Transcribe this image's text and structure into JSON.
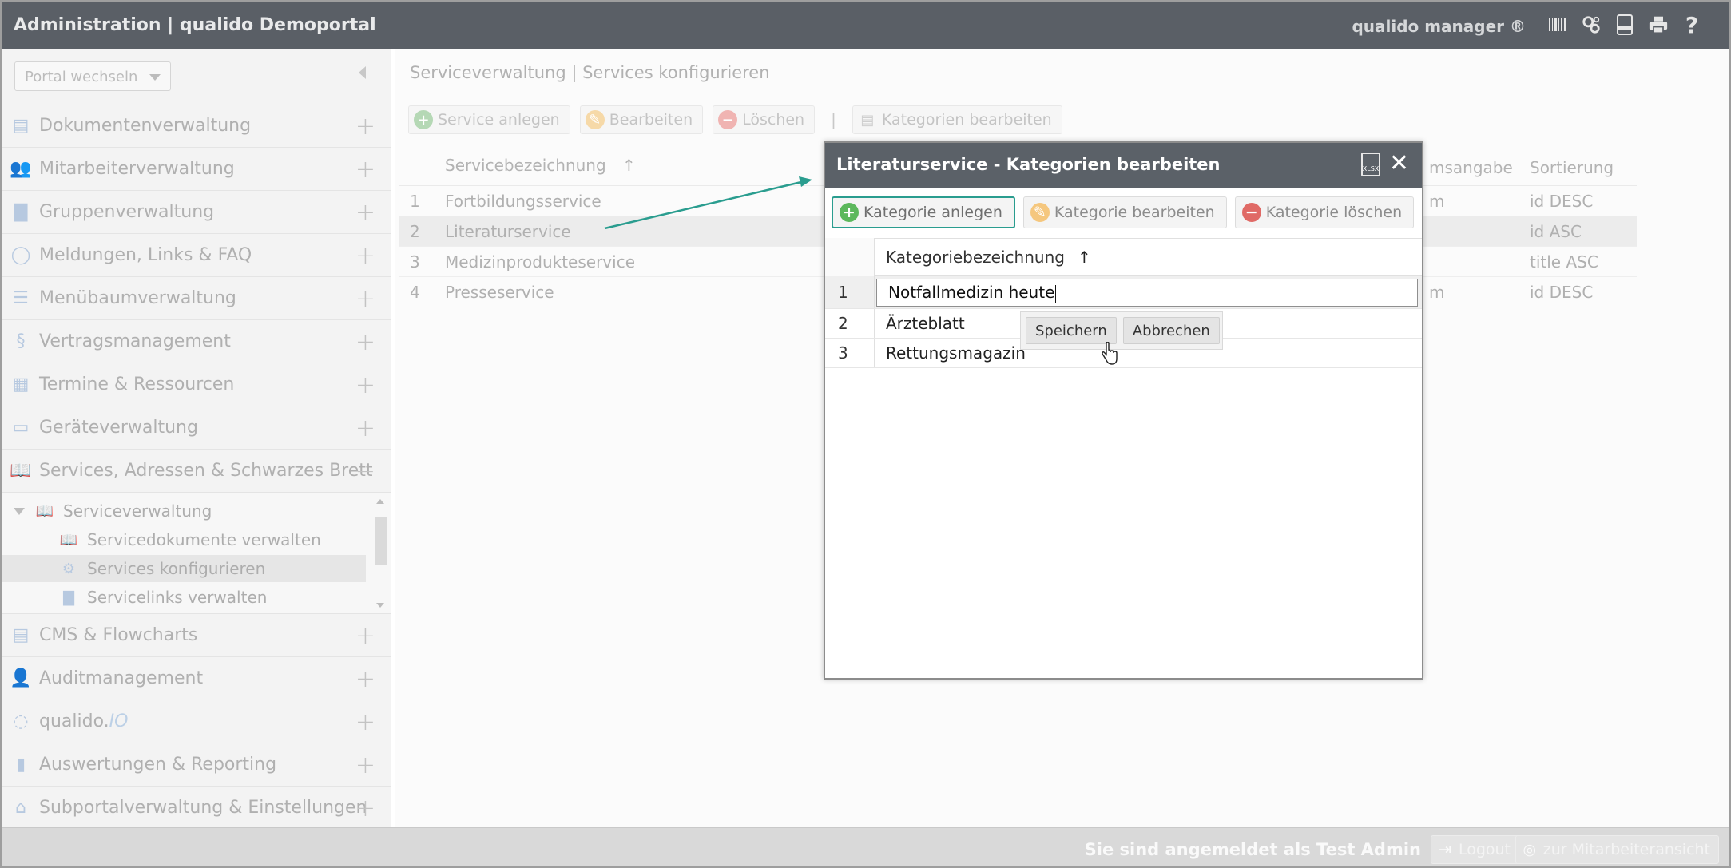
{
  "header": {
    "title": "Administration | qualido Demoportal",
    "product": "qualido manager ®",
    "icons": [
      "barcode-icon",
      "gears-icon",
      "xlsx-export-icon",
      "print-icon",
      "help-icon"
    ]
  },
  "sidebar": {
    "portal_select": "Portal wechseln",
    "items": [
      {
        "label": "Dokumentenverwaltung",
        "icon": "documents-icon"
      },
      {
        "label": "Mitarbeiterverwaltung",
        "icon": "users-icon"
      },
      {
        "label": "Gruppenverwaltung",
        "icon": "group-folder-icon"
      },
      {
        "label": "Meldungen, Links & FAQ",
        "icon": "chat-icon"
      },
      {
        "label": "Menübaumverwaltung",
        "icon": "list-icon"
      },
      {
        "label": "Vertragsmanagement",
        "icon": "paragraph-icon"
      },
      {
        "label": "Termine & Ressourcen",
        "icon": "calendar-icon"
      },
      {
        "label": "Geräteverwaltung",
        "icon": "monitor-icon"
      },
      {
        "label": "Services, Adressen & Schwarzes Brett",
        "icon": "book-icon"
      }
    ],
    "subtree": {
      "parent": "Serviceverwaltung",
      "children": [
        "Servicedokumente verwalten",
        "Services konfigurieren",
        "Servicelinks verwalten"
      ]
    },
    "items_after": [
      {
        "label": "CMS & Flowcharts",
        "icon": "cms-icon"
      },
      {
        "label": "Auditmanagement",
        "icon": "auditor-icon"
      },
      {
        "label": "qualido.",
        "label_io": "IO",
        "icon": "qualido-io-icon"
      },
      {
        "label": "Auswertungen & Reporting",
        "icon": "bar-chart-icon"
      },
      {
        "label": "Subportalverwaltung & Einstellungen",
        "icon": "home-icon"
      }
    ]
  },
  "main": {
    "breadcrumb": "Serviceverwaltung | Services konfigurieren",
    "toolbar": {
      "add": "Service anlegen",
      "edit": "Bearbeiten",
      "delete": "Löschen",
      "separator": "|",
      "categories": "Kategorien bearbeiten"
    },
    "table": {
      "columns": [
        "Servicebezeichnung",
        "msangabe",
        "Sortierung"
      ],
      "sort_arrow": "↑",
      "rows": [
        {
          "num": "1",
          "name": "Fortbildungsservice",
          "date": "m",
          "sort": "id DESC"
        },
        {
          "num": "2",
          "name": "Literaturservice",
          "date": "",
          "sort": "id ASC"
        },
        {
          "num": "3",
          "name": "Medizinprodukteservice",
          "date": "",
          "sort": "title ASC"
        },
        {
          "num": "4",
          "name": "Presseservice",
          "date": "m",
          "sort": "id DESC"
        }
      ]
    }
  },
  "modal": {
    "title": "Literaturservice - Kategorien bearbeiten",
    "xlsx_label": "XLSX",
    "close": "✕",
    "toolbar": {
      "add": "Kategorie anlegen",
      "edit": "Kategorie bearbeiten",
      "delete": "Kategorie löschen"
    },
    "column": "Kategoriebezeichnung",
    "sort_arrow": "↑",
    "edit_value": "Notfallmedizin heute",
    "rows": [
      {
        "num": "1",
        "name": "Notfallmedizin heute"
      },
      {
        "num": "2",
        "name": "Ärzteblatt"
      },
      {
        "num": "3",
        "name": "Rettungsmagazin"
      }
    ],
    "popup": {
      "save": "Speichern",
      "cancel": "Abbrechen"
    }
  },
  "footer": {
    "logged_in_prefix": "Sie sind angemeldet als",
    "user": "Test Admin",
    "logout": "Logout",
    "employee_view": "zur Mitarbeiteransicht"
  },
  "colors": {
    "header_bg": "#5a5f66",
    "modal_header_bg": "#5b6168",
    "accent_green": "#5cb85c",
    "accent_orange": "#f0ad4e",
    "accent_red": "#d9534f",
    "highlight_teal": "#2a9d8f"
  }
}
